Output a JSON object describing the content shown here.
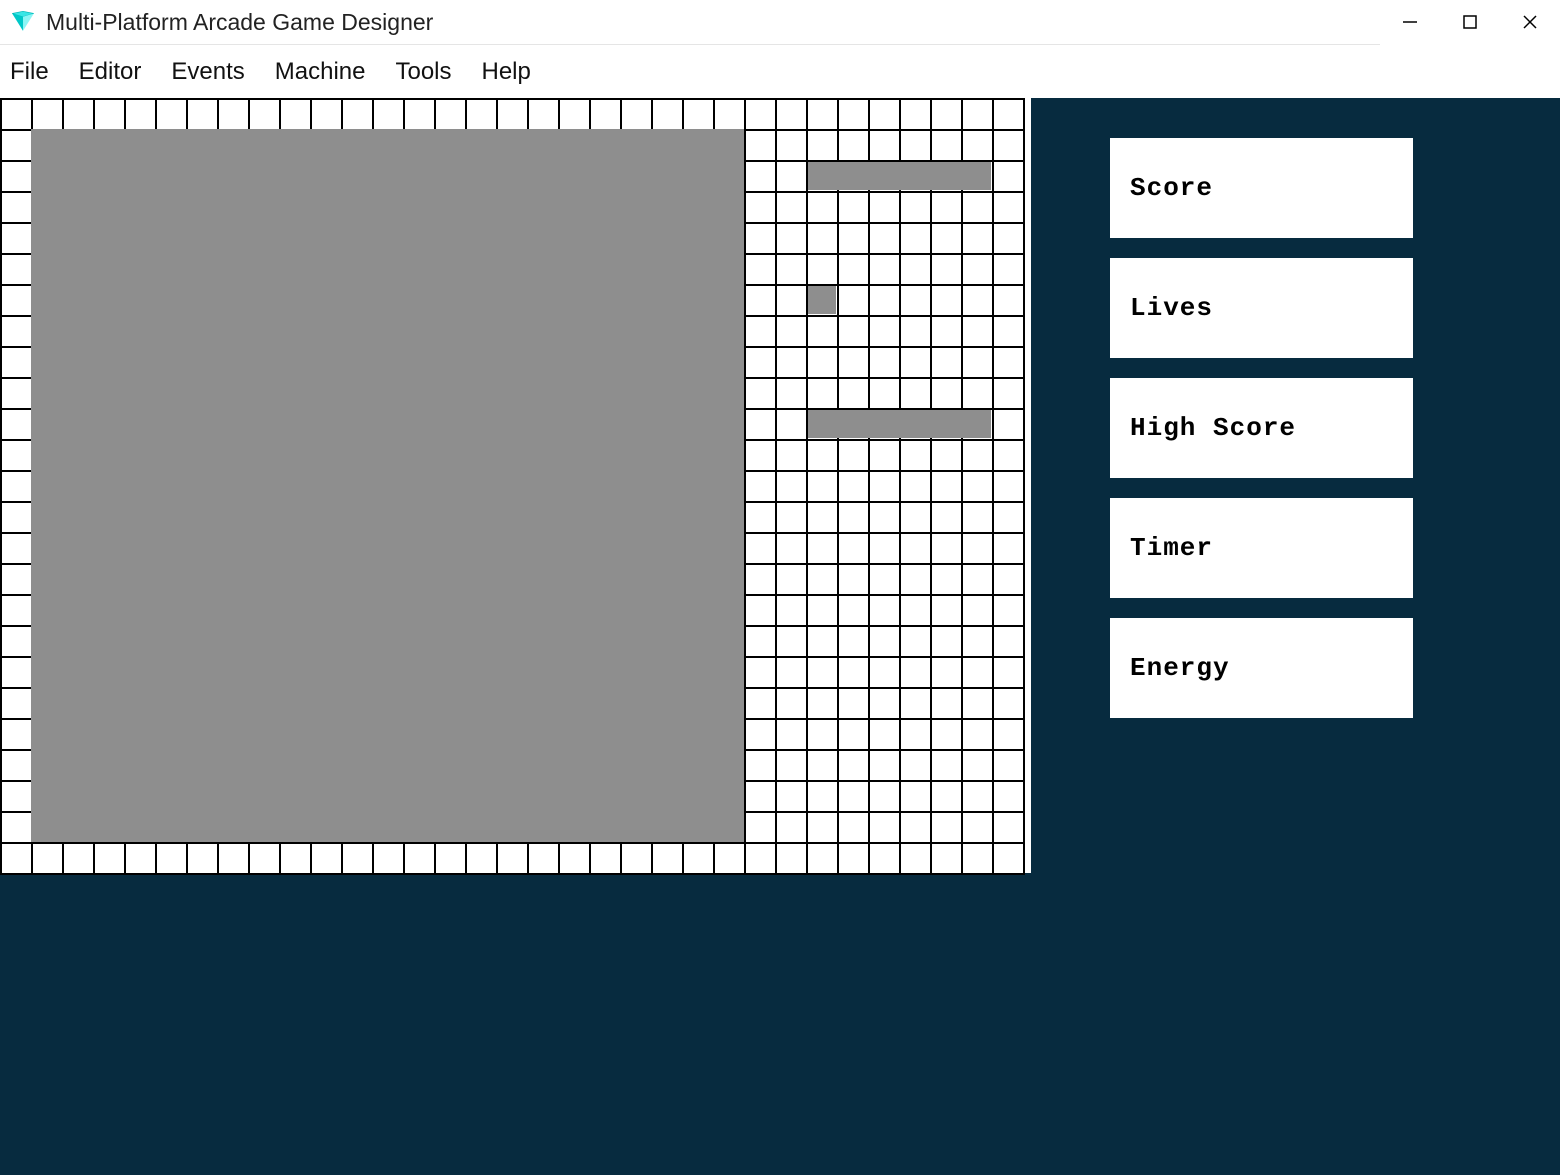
{
  "app": {
    "title": "Multi-Platform Arcade Game Designer"
  },
  "menu": {
    "items": [
      "File",
      "Editor",
      "Events",
      "Machine",
      "Tools",
      "Help"
    ]
  },
  "side_buttons": [
    "Score",
    "Lives",
    "High Score",
    "Timer",
    "Energy"
  ],
  "grid": {
    "cols": 33,
    "rows": 25,
    "cell": 31,
    "viewport": {
      "col": 1,
      "row": 1,
      "w": 23,
      "h": 23
    },
    "placed": [
      {
        "col": 26,
        "row": 2,
        "w": 6,
        "h": 1
      },
      {
        "col": 26,
        "row": 6,
        "w": 1,
        "h": 1
      },
      {
        "col": 26,
        "row": 10,
        "w": 6,
        "h": 1
      }
    ]
  },
  "colors": {
    "workspace_bg": "#072b3f",
    "grey_fill": "#8e8e8e"
  }
}
